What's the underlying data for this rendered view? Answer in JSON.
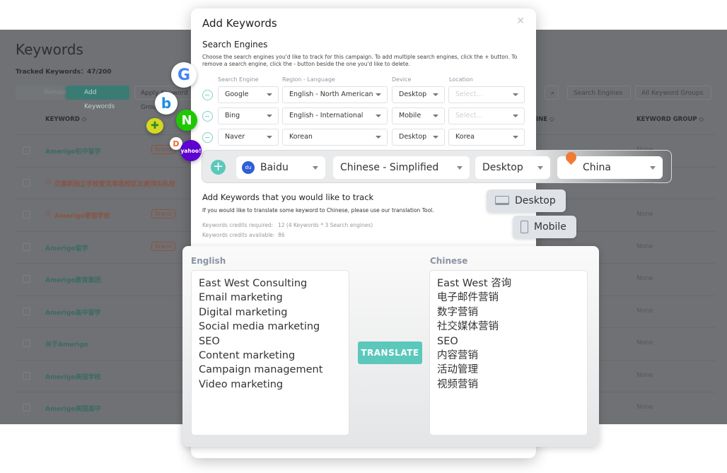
{
  "page": {
    "title": "Keywords",
    "tracked": "Tracked Keywords：47/200",
    "remove": "Remove",
    "add_keywords": "Add Keywords",
    "apply_group": "Apply Keyword Group",
    "search_engines_filter": "Search Engines",
    "keyword_groups_filter": "All Keyword Groups",
    "col_keyword": "KEYWORD ◇",
    "col_engine": "INE ◇",
    "col_group": "KEYWORD GROUP ◇",
    "rows": [
      {
        "kw": "Amerigo初中留学",
        "brand": "Brand",
        "group": "None",
        "pending": false
      },
      {
        "kw": "贝塞斯独立学校麦克莱恩校区北美顶尖私校",
        "brand": "",
        "group": "None",
        "pending": true
      },
      {
        "kw": "Amerigo寄宿学校",
        "brand": "Brand",
        "group": "None",
        "pending": true
      },
      {
        "kw": "Amerigo留学",
        "brand": "Brand",
        "group": "None",
        "pending": false
      },
      {
        "kw": "Amerigo教育集团",
        "brand": "",
        "group": "None",
        "pending": false
      },
      {
        "kw": "Amerigo高中留学",
        "brand": "",
        "group": "None",
        "pending": false
      },
      {
        "kw": "关于Amerigo",
        "brand": "",
        "group": "None",
        "pending": false
      },
      {
        "kw": "Amerigo美国学校",
        "brand": "",
        "group": "None",
        "pending": false
      },
      {
        "kw": "Amerigo美国高中",
        "brand": "",
        "group": "None",
        "pending": false
      }
    ]
  },
  "modal": {
    "title": "Add Keywords",
    "close": "✕",
    "se_heading": "Search Engines",
    "se_desc": "Choose the search engines you'd like to track for this campaign. To add multiple search engines, click the + button. To remove a search engine, click the - button beside the one you'd like to delete.",
    "labels": {
      "engine": "Search Engine",
      "region": "Region - Language",
      "device": "Device",
      "location": "Location"
    },
    "engines": [
      {
        "engine": "Google",
        "region": "English - North American",
        "device": "Desktop",
        "location": "Select...",
        "placeholder": true
      },
      {
        "engine": "Bing",
        "region": "English - International",
        "device": "Mobile",
        "location": "Select...",
        "placeholder": true
      },
      {
        "engine": "Naver",
        "region": "Korean",
        "device": "Desktop",
        "location": "Korea",
        "placeholder": false
      }
    ],
    "new_row": {
      "engine": "Baidu",
      "region": "Chinese - Simplified",
      "device": "Desktop",
      "location": "China"
    },
    "device_options": [
      "Desktop",
      "Mobile"
    ],
    "kw_heading": "Add Keywords that you would like to track",
    "kw_desc": "If you would like to translate some keyword to Chinese, please use our translation Tool.",
    "credits_required_label": "Keywords credits required:",
    "credits_required": "12 (4 Keywords * 3 Search engines)",
    "credits_available_label": "Keywords credits available:",
    "credits_available": "86"
  },
  "logos": {
    "google": "G",
    "bing": "b",
    "naver": "N",
    "daum": "D",
    "yahoo": "yahoo!"
  },
  "translate": {
    "english_label": "English",
    "chinese_label": "Chinese",
    "button": "TRANSLATE",
    "english": [
      "East West Consulting",
      "Email marketing",
      "Digital marketing",
      "Social media marketing",
      "SEO",
      "Content marketing",
      "Campaign management",
      "Video marketing"
    ],
    "chinese": [
      "East West 咨询",
      "电子邮件营销",
      "数字营销",
      "社交媒体营销",
      "SEO",
      "内容营销",
      "活动管理",
      "视频营销"
    ]
  },
  "colors": {
    "accent": "#5cc8bc",
    "overlay": "#6f7174",
    "pin": "#ef7b35"
  }
}
